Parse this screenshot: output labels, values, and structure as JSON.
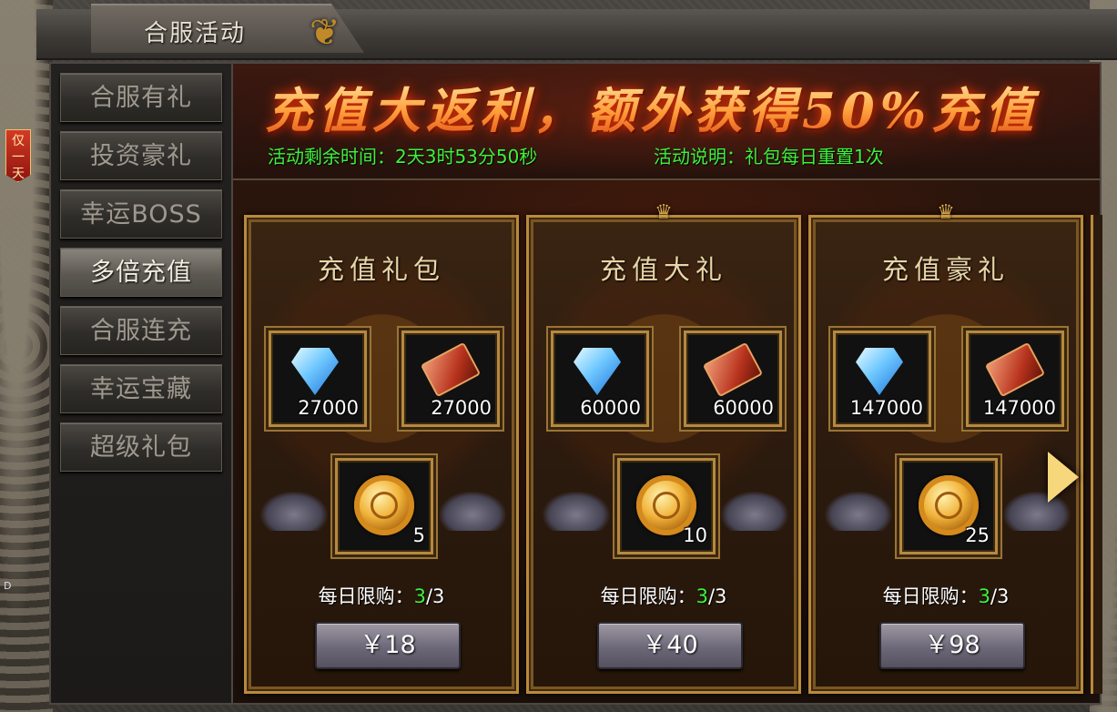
{
  "window": {
    "title": "合服活动"
  },
  "sidebar": {
    "badge": "仅一天",
    "items": [
      {
        "label": "合服有礼"
      },
      {
        "label": "投资豪礼"
      },
      {
        "label": "幸运BOSS"
      },
      {
        "label": "多倍充值"
      },
      {
        "label": "合服连充"
      },
      {
        "label": "幸运宝藏"
      },
      {
        "label": "超级礼包"
      }
    ],
    "active_index": 3
  },
  "banner": {
    "headline": "充值大返利，额外获得50%充值",
    "time_left": "活动剩余时间：2天3时53分50秒",
    "description": "活动说明：礼包每日重置1次"
  },
  "cards": [
    {
      "title": "充值礼包",
      "items": [
        {
          "icon": "diamond-icon",
          "qty": "27000"
        },
        {
          "icon": "scroll-icon",
          "qty": "27000"
        },
        {
          "icon": "coin-icon",
          "qty": "5"
        }
      ],
      "limit_label": "每日限购：",
      "limit_current": "3",
      "limit_total": "/3",
      "price": "￥18"
    },
    {
      "title": "充值大礼",
      "items": [
        {
          "icon": "diamond-icon",
          "qty": "60000"
        },
        {
          "icon": "scroll-icon",
          "qty": "60000"
        },
        {
          "icon": "coin-icon",
          "qty": "10"
        }
      ],
      "limit_label": "每日限购：",
      "limit_current": "3",
      "limit_total": "/3",
      "price": "￥40"
    },
    {
      "title": "充值豪礼",
      "items": [
        {
          "icon": "diamond-icon",
          "qty": "147000"
        },
        {
          "icon": "scroll-icon",
          "qty": "147000"
        },
        {
          "icon": "coin-icon",
          "qty": "25"
        }
      ],
      "limit_label": "每日限购：",
      "limit_current": "3",
      "limit_total": "/3",
      "price": "￥98"
    }
  ],
  "edge_marker": "D",
  "colors": {
    "accent_green": "#3cf13c",
    "headline_orange": "#ffa03c",
    "gold_border": "#b98a3c"
  }
}
